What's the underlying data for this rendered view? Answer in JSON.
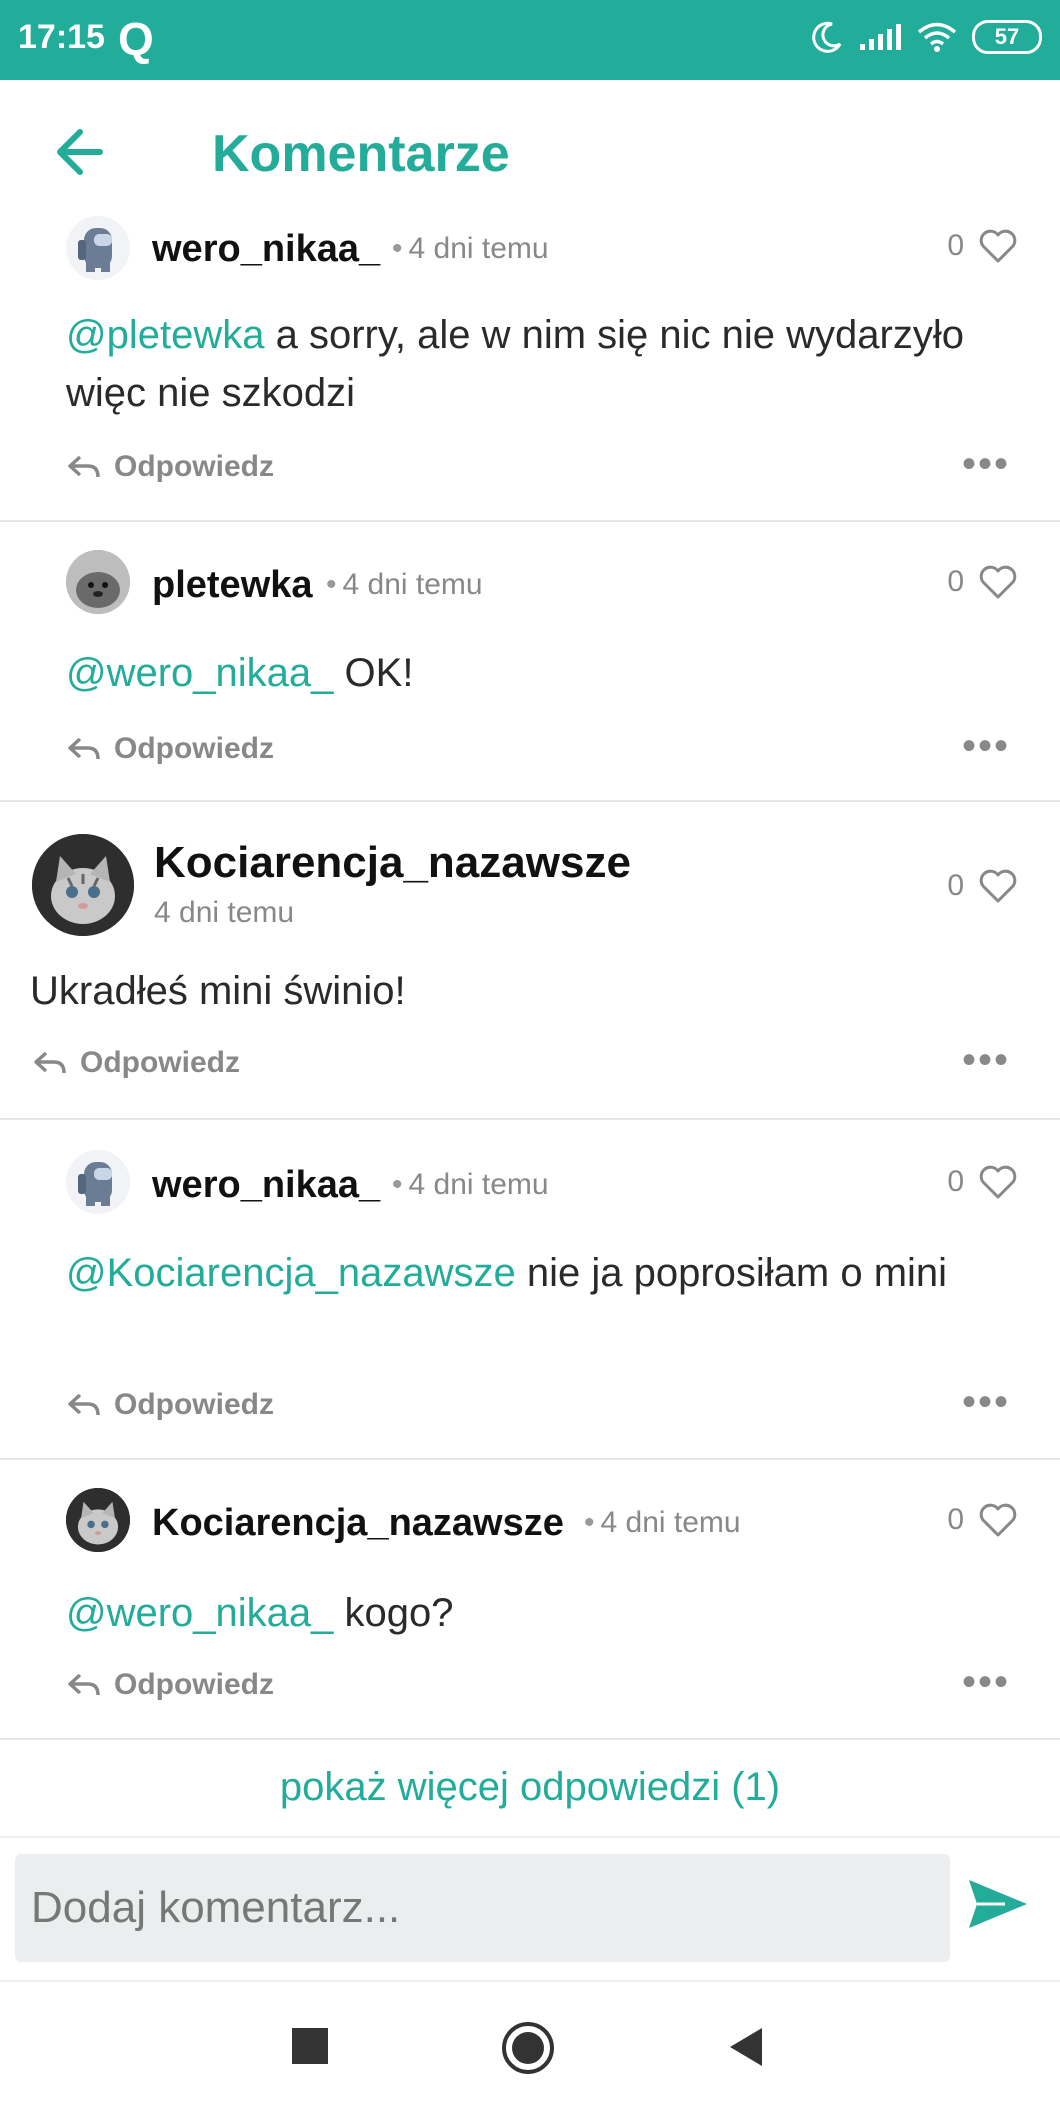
{
  "status_bar": {
    "time": "17:15",
    "app_letter": "Q",
    "battery": "57",
    "icons": [
      "moon-icon",
      "signal-icon",
      "wifi-icon",
      "battery-icon"
    ]
  },
  "header": {
    "title": "Komentarze",
    "back_icon": "arrow-left-icon"
  },
  "comments": [
    {
      "username": "wero_nikaa_",
      "time": "4 dni temu",
      "likes": "0",
      "mention": "@pletewka",
      "text": " a sorry, ale w nim się nic nie wydarzyło więc nie szkodzi",
      "reply_label": "Odpowiedz",
      "more_label": "•••"
    },
    {
      "username": "pletewka",
      "time": "4 dni temu",
      "likes": "0",
      "mention": "@wero_nikaa_",
      "text": " OK!",
      "reply_label": "Odpowiedz",
      "more_label": "•••"
    },
    {
      "username": "Kociarencja_nazawsze",
      "time": "4 dni temu",
      "likes": "0",
      "mention": "",
      "text": "Ukradłeś mini świnio!",
      "reply_label": "Odpowiedz",
      "more_label": "•••"
    },
    {
      "username": "wero_nikaa_",
      "time": "4 dni temu",
      "likes": "0",
      "mention": "@Kociarencja_nazawsze",
      "text": " nie ja poprosiłam o mini",
      "reply_label": "Odpowiedz",
      "more_label": "•••"
    },
    {
      "username": "Kociarencja_nazawsze",
      "time": "4 dni temu",
      "likes": "0",
      "mention": "@wero_nikaa_",
      "text": " kogo?",
      "reply_label": "Odpowiedz",
      "more_label": "•••"
    }
  ],
  "show_more": "pokaż więcej odpowiedzi (1)",
  "input": {
    "placeholder": "Dodaj komentarz...",
    "value": ""
  },
  "colors": {
    "accent": "#22ac99",
    "status_bar": "#21ad99",
    "muted": "#888888"
  }
}
